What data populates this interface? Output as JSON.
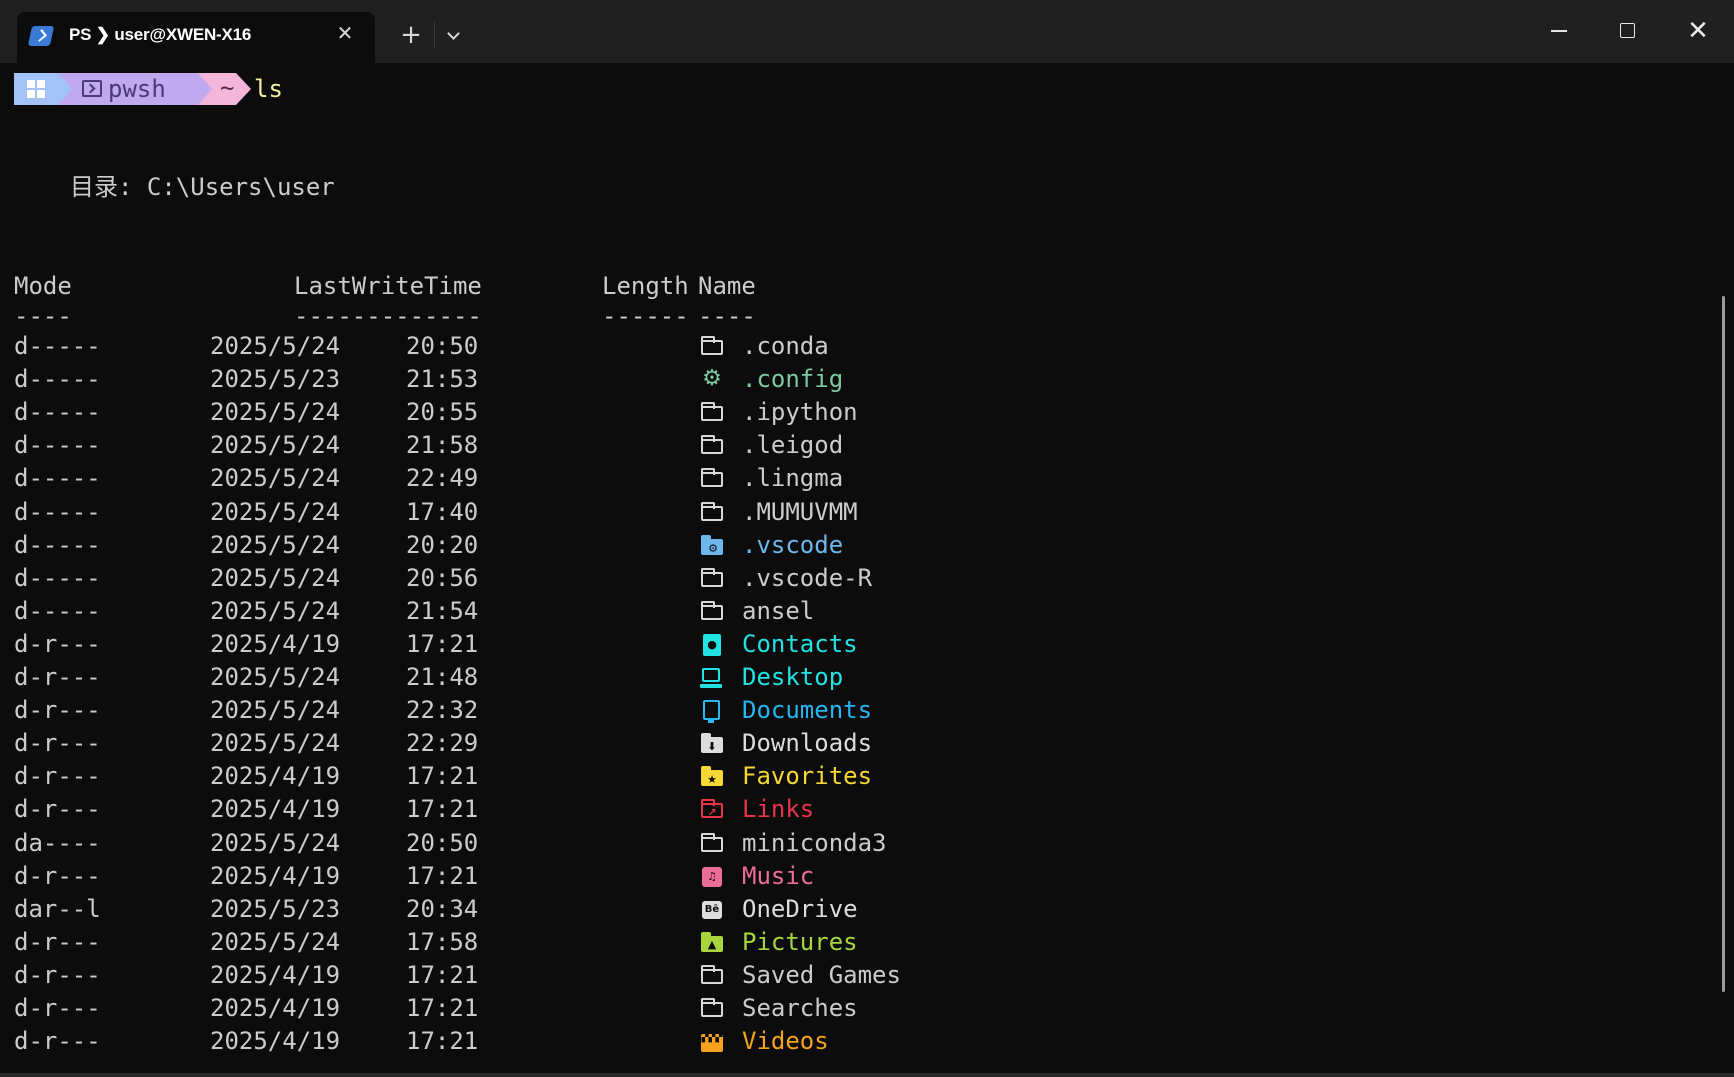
{
  "window": {
    "tab_title": "PS ❯ user@XWEN-X16",
    "close_glyph": "✕",
    "new_tab_glyph": "+",
    "win_close_glyph": "✕"
  },
  "prompt": {
    "shell": "pwsh",
    "path": "~",
    "command": "ls",
    "colors": {
      "os_segment": "#a3c3f7",
      "shell_segment": "#c0a9ef",
      "path_segment": "#f3b6d8",
      "command": "#f9f1a5"
    }
  },
  "listing": {
    "directory_line": "目录: C:\\Users\\user",
    "headers": {
      "mode": "Mode",
      "last_write_time": "LastWriteTime",
      "length": "Length",
      "name": "Name"
    },
    "dashes": {
      "mode": "----",
      "last_write_time": "-------------",
      "length": "------",
      "name": "----"
    },
    "rows": [
      {
        "mode": "d-----",
        "date": "2025/5/24",
        "time": "20:50",
        "name": ".conda",
        "icon": "folder-icon",
        "color": "#cccccc"
      },
      {
        "mode": "d-----",
        "date": "2025/5/23",
        "time": "21:53",
        "name": ".config",
        "icon": "gear-icon",
        "color": "#7ec9a2"
      },
      {
        "mode": "d-----",
        "date": "2025/5/24",
        "time": "20:55",
        "name": ".ipython",
        "icon": "folder-icon",
        "color": "#cccccc"
      },
      {
        "mode": "d-----",
        "date": "2025/5/24",
        "time": "21:58",
        "name": ".leigod",
        "icon": "folder-icon",
        "color": "#cccccc"
      },
      {
        "mode": "d-----",
        "date": "2025/5/24",
        "time": "22:49",
        "name": ".lingma",
        "icon": "folder-icon",
        "color": "#cccccc"
      },
      {
        "mode": "d-----",
        "date": "2025/5/24",
        "time": "17:40",
        "name": ".MUMUVMM",
        "icon": "folder-icon",
        "color": "#cccccc"
      },
      {
        "mode": "d-----",
        "date": "2025/5/24",
        "time": "20:20",
        "name": ".vscode",
        "icon": "folder-gear-icon",
        "color": "#6fb8ee"
      },
      {
        "mode": "d-----",
        "date": "2025/5/24",
        "time": "20:56",
        "name": ".vscode-R",
        "icon": "folder-icon",
        "color": "#cccccc"
      },
      {
        "mode": "d-----",
        "date": "2025/5/24",
        "time": "21:54",
        "name": "ansel",
        "icon": "folder-icon",
        "color": "#cccccc"
      },
      {
        "mode": "d-r---",
        "date": "2025/4/19",
        "time": "17:21",
        "name": "Contacts",
        "icon": "contacts-icon",
        "color": "#22e3e3"
      },
      {
        "mode": "d-r---",
        "date": "2025/5/24",
        "time": "21:48",
        "name": "Desktop",
        "icon": "desktop-icon",
        "color": "#22e3e3"
      },
      {
        "mode": "d-r---",
        "date": "2025/5/24",
        "time": "22:32",
        "name": "Documents",
        "icon": "documents-icon",
        "color": "#27b6f0"
      },
      {
        "mode": "d-r---",
        "date": "2025/5/24",
        "time": "22:29",
        "name": "Downloads",
        "icon": "downloads-icon",
        "color": "#dddddd"
      },
      {
        "mode": "d-r---",
        "date": "2025/4/19",
        "time": "17:21",
        "name": "Favorites",
        "icon": "favorites-icon",
        "color": "#f7d736"
      },
      {
        "mode": "d-r---",
        "date": "2025/4/19",
        "time": "17:21",
        "name": "Links",
        "icon": "links-icon",
        "color": "#e8344a"
      },
      {
        "mode": "da----",
        "date": "2025/5/24",
        "time": "20:50",
        "name": "miniconda3",
        "icon": "folder-icon",
        "color": "#cccccc"
      },
      {
        "mode": "d-r---",
        "date": "2025/4/19",
        "time": "17:21",
        "name": "Music",
        "icon": "music-icon",
        "color": "#ec6d9a"
      },
      {
        "mode": "dar--l",
        "date": "2025/5/23",
        "time": "20:34",
        "name": "OneDrive",
        "icon": "onedrive-icon",
        "color": "#dddddd"
      },
      {
        "mode": "d-r---",
        "date": "2025/5/24",
        "time": "17:58",
        "name": "Pictures",
        "icon": "pictures-icon",
        "color": "#a6d63c"
      },
      {
        "mode": "d-r---",
        "date": "2025/4/19",
        "time": "17:21",
        "name": "Saved Games",
        "icon": "folder-icon",
        "color": "#cccccc"
      },
      {
        "mode": "d-r---",
        "date": "2025/4/19",
        "time": "17:21",
        "name": "Searches",
        "icon": "folder-icon",
        "color": "#cccccc"
      },
      {
        "mode": "d-r---",
        "date": "2025/4/19",
        "time": "17:21",
        "name": "Videos",
        "icon": "videos-icon",
        "color": "#f5a21c"
      }
    ]
  }
}
